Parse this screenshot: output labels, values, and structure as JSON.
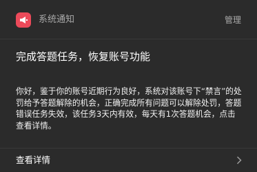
{
  "notification": {
    "sender": "系统通知",
    "manage_label": "管理",
    "app_icon": "megaphone-icon",
    "accent_color": "#ec4a5a",
    "title": "完成答题任务，恢复账号功能",
    "body": "你好，鉴于你的账号近期行为良好，系统对该账号下“禁言”的处罚给予答题解除的机会，正确完成所有问题可以解除处罚，答题错误任务失效，该任务3天内有效，每天有1次答题机会，点击查看详情。",
    "detail_label": "查看详情",
    "detail_icon": "chevron-right-icon"
  }
}
